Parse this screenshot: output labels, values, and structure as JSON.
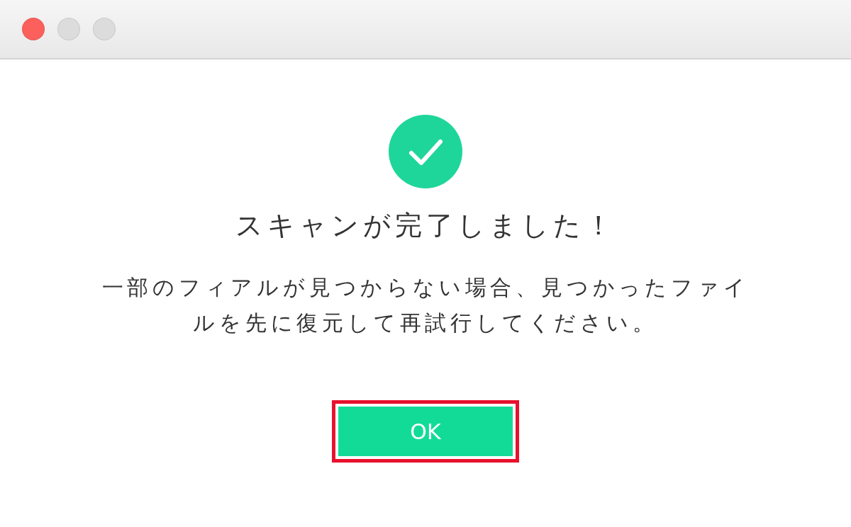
{
  "window": {
    "controls": [
      {
        "color": "#fc605c"
      },
      {
        "color": "#dcdcdc"
      },
      {
        "color": "#dcdcdc"
      }
    ]
  },
  "dialog": {
    "title": "スキャンが完了しました！",
    "message": "一部のフィアルが見つからない場合、見つかったファイルを先に復元して再試行してください。",
    "button": {
      "label": "OK",
      "highlighted": true
    }
  }
}
